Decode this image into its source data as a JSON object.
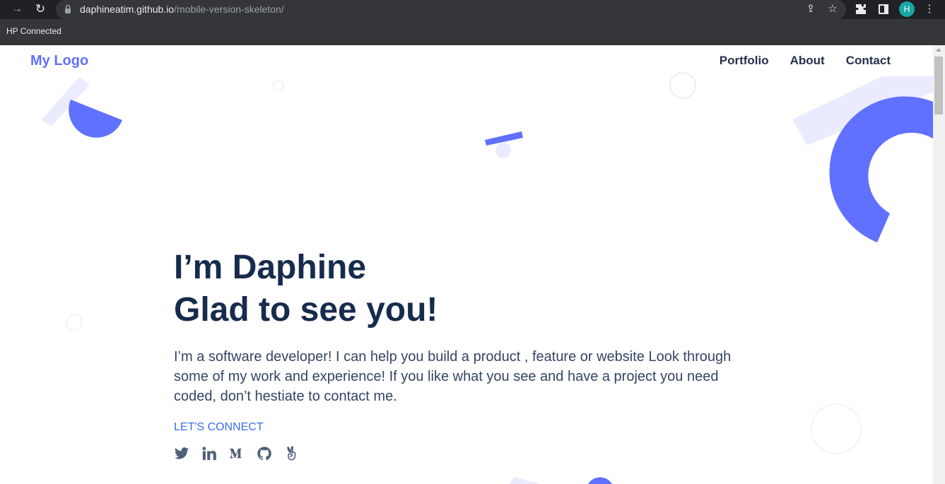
{
  "browser": {
    "url_host": "daphineatim.github.io",
    "url_path": "/mobile-version-skeleton/",
    "profile_initial": "H",
    "bookmark": "HP Connected",
    "icons": [
      "arrow-forward-icon",
      "reload-icon",
      "lock-icon",
      "share-icon",
      "star-icon",
      "extensions-icon",
      "sidepanel-icon",
      "kebab-menu-icon"
    ]
  },
  "header": {
    "logo": "My Logo",
    "nav": [
      "Portfolio",
      "About",
      "Contact"
    ]
  },
  "hero": {
    "headline_1": "I’m Daphine",
    "headline_2": "Glad to see you!",
    "intro": "I’m a software developer! I can help you build a product , feature or website Look through some of my work and experience! If you like what you see and have a project you need coded, don’t hestiate to contact me.",
    "cta": "LET'S CONNECT",
    "social_icons": [
      "twitter-icon",
      "linkedin-icon",
      "medium-icon",
      "github-icon",
      "angellist-icon"
    ]
  },
  "colors": {
    "accent": "#6070ff",
    "accent_light": "#ebebff",
    "heading": "#172b4d",
    "body_text": "#344563",
    "link": "#396df2"
  }
}
